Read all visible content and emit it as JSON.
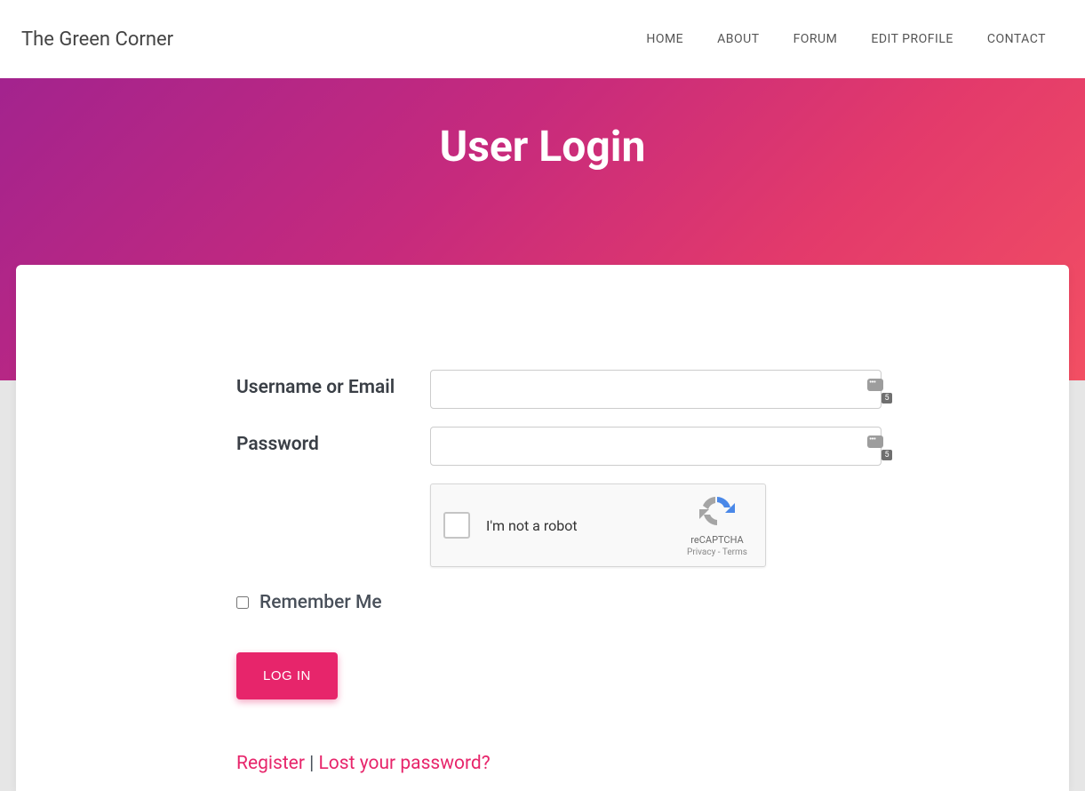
{
  "brand": "The Green Corner",
  "nav": {
    "home": "HOME",
    "about": "ABOUT",
    "forum": "FORUM",
    "edit_profile": "EDIT PROFILE",
    "contact": "CONTACT"
  },
  "hero": {
    "title": "User Login"
  },
  "form": {
    "username_label": "Username or Email",
    "username_value": "",
    "password_label": "Password",
    "password_value": "",
    "pw_badge": "5",
    "captcha_label": "I'm not a robot",
    "captcha_brand": "reCAPTCHA",
    "captcha_terms_privacy": "Privacy",
    "captcha_terms_sep": " - ",
    "captcha_terms_terms": "Terms",
    "remember_label": "Remember Me",
    "login_button": "LOG IN",
    "register_link": "Register",
    "links_sep": " | ",
    "lost_password_link": "Lost your password?"
  }
}
